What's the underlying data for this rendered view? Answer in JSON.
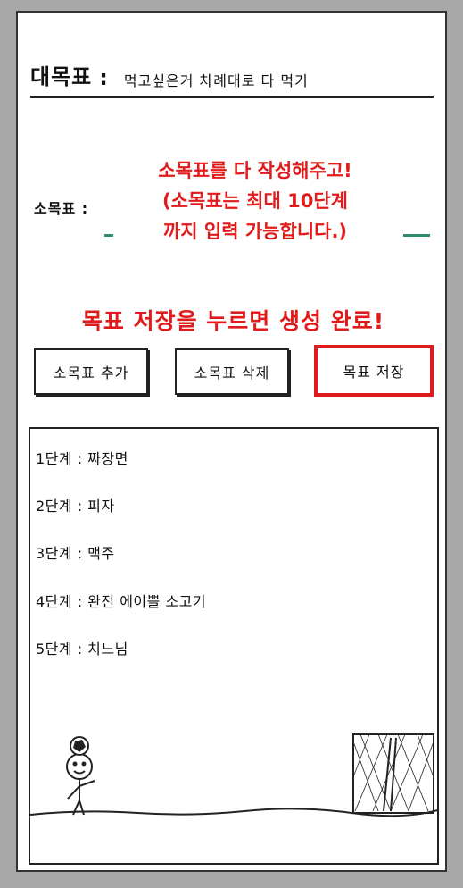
{
  "big_goal": {
    "label": "대목표",
    "colon": ":",
    "value": "먹고싶은거 차례대로 다 먹기"
  },
  "sub_goal": {
    "label": "소목표 :"
  },
  "hint": {
    "lines": [
      "소목표를 다 작성해주고!",
      "(소목표는 최대 10단계",
      "까지 입력 가능합니다.)"
    ]
  },
  "save_hint": "목표 저장을 누르면 생성 완료!",
  "buttons": {
    "add": "소목표 추가",
    "delete": "소목표 삭제",
    "save": "목표 저장"
  },
  "steps": [
    "1단계 : 짜장면",
    "2단계 : 피자",
    "3단계 : 맥주",
    "4단계 : 완전 에이쁠 소고기",
    "5단계 : 치느님"
  ],
  "colors": {
    "accent_red": "#e01b1b",
    "dash_green": "#2f8c6a"
  }
}
